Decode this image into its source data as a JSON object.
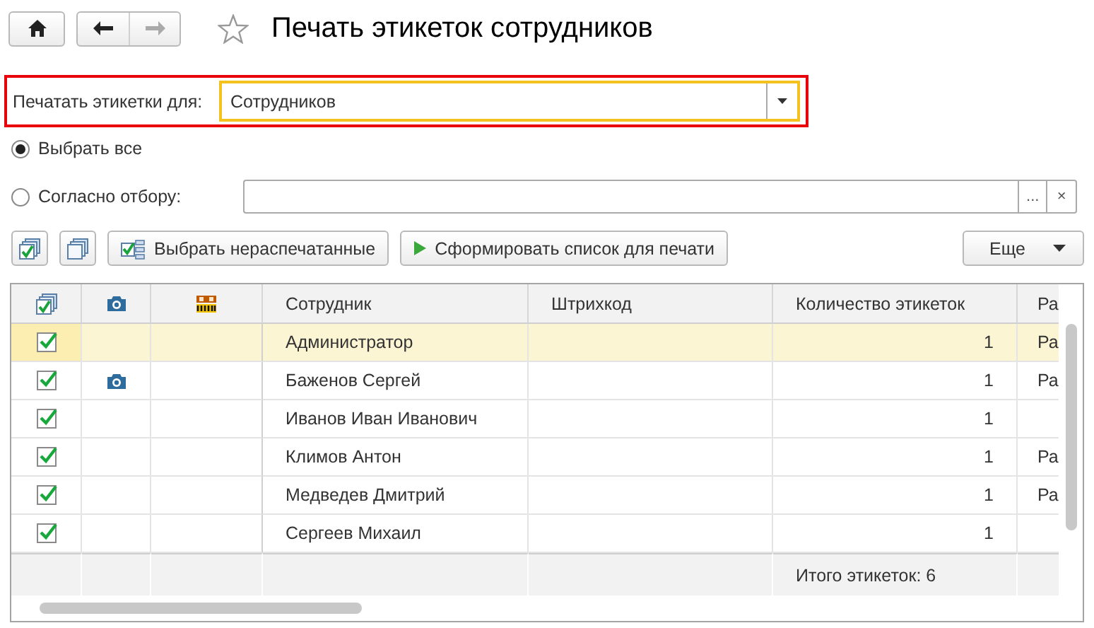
{
  "header": {
    "title": "Печать этикеток сотрудников"
  },
  "print_for": {
    "label": "Печатать этикетки для:",
    "value": "Сотрудников",
    "highlighted": true
  },
  "selection": [
    {
      "label": "Выбрать все",
      "selected": true
    },
    {
      "label": "Согласно отбору:",
      "selected": false
    }
  ],
  "filter_field": {
    "select_button": "...",
    "clear_button": "×"
  },
  "buttons": [
    {
      "kind": "check_all"
    },
    {
      "kind": "uncheck_all"
    },
    {
      "kind": "select_unprinted",
      "label": "Выбрать нераспечатанные"
    },
    {
      "kind": "generate",
      "label": "Сформировать список для печати"
    },
    {
      "kind": "more",
      "label": "Еще"
    }
  ],
  "table": {
    "columns": [
      {
        "kind": "check"
      },
      {
        "kind": "photo"
      },
      {
        "kind": "barcode"
      },
      {
        "kind": "text",
        "label": "Сотрудник"
      },
      {
        "kind": "text",
        "label": "Штрихкод"
      },
      {
        "kind": "text",
        "label": "Количество этикеток"
      },
      {
        "kind": "text",
        "label": "Ра"
      }
    ],
    "rows": [
      {
        "checked": true,
        "has_photo": false,
        "employee": "Администратор",
        "quantity": "1",
        "column_7": "Ра",
        "selected": true
      },
      {
        "checked": true,
        "has_photo": true,
        "employee": "Баженов Сергей",
        "quantity": "1",
        "column_7": "Ра",
        "selected": false
      },
      {
        "checked": true,
        "has_photo": false,
        "employee": "Иванов Иван Иванович",
        "quantity": "1",
        "selected": false
      },
      {
        "checked": true,
        "has_photo": false,
        "employee": "Климов Антон",
        "quantity": "1",
        "column_7": "Ра",
        "selected": false
      },
      {
        "checked": true,
        "has_photo": false,
        "employee": "Медведев Дмитрий",
        "quantity": "1",
        "column_7": "Ра",
        "selected": false
      },
      {
        "checked": true,
        "has_photo": false,
        "employee": "Сергеев Михаил",
        "quantity": "1",
        "selected": false
      }
    ],
    "footer": {
      "total": "Итого этикеток: 6"
    }
  }
}
